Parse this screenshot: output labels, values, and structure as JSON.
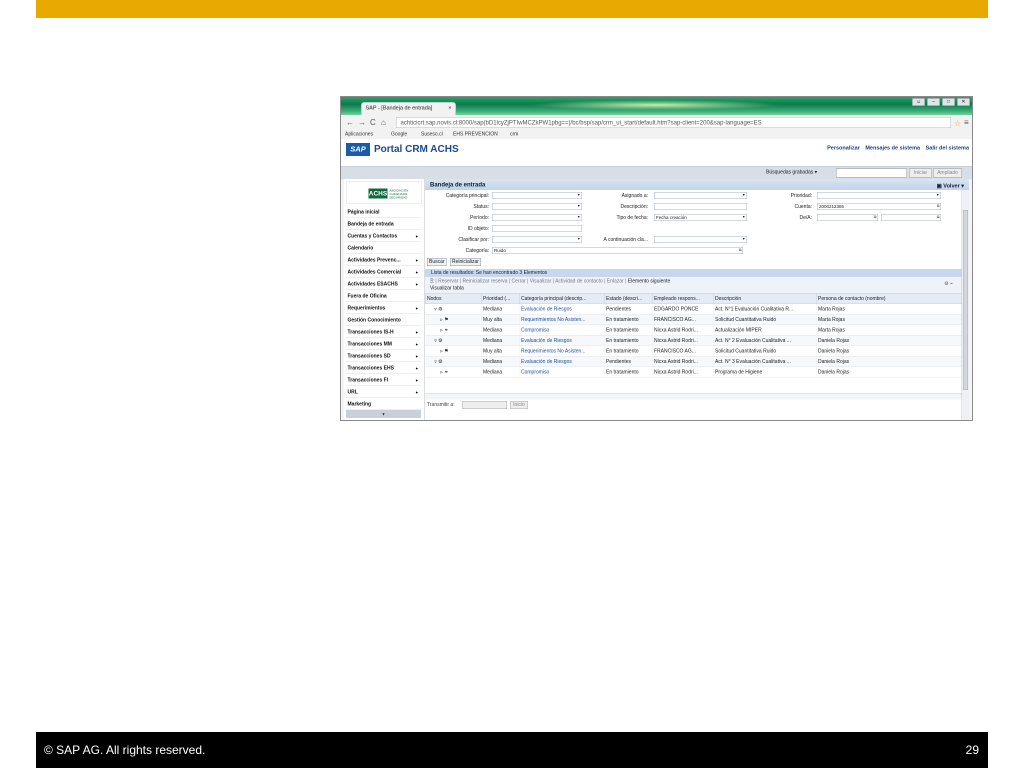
{
  "footer": {
    "copyright": "©  SAP AG. All rights reserved.",
    "page_number": "29"
  },
  "browser": {
    "tab_title": "SAP - [Bandeja de entrada]",
    "tab_close": "×",
    "url": "achticicrt.sap.novis.cl:8000/sap(bD1lcyZjPTIwMCZkPW1pbg==)/bc/bsp/sap/crm_ui_start/default.htm?sap-client=200&sap-language=ES",
    "bookmarks": [
      "Aplicaciones",
      "Google",
      "Suseso.cl",
      "EHS PREVENCION",
      "crm"
    ]
  },
  "sap": {
    "logo": "SAP",
    "portal_title": "Portal CRM ACHS",
    "header_links": [
      "Personalizar",
      "Mensajes de sistema",
      "Salir del sistema"
    ],
    "saved_searches_label": "Búsquedas grabadas",
    "start_button": "Iniciar",
    "expanded_button": "Ampliado"
  },
  "nav": {
    "logo_text": "ACHS",
    "logo_sub": "ASOCIACIÓN CHILENA DE SEGURIDAD",
    "items": [
      {
        "label": "Página inicial",
        "arrow": ""
      },
      {
        "label": "Bandeja de entrada",
        "arrow": ""
      },
      {
        "label": "Cuentas y Contactos",
        "arrow": "▸"
      },
      {
        "label": "Calendario",
        "arrow": ""
      },
      {
        "label": "Actividades Prevenc...",
        "arrow": "▸"
      },
      {
        "label": "Actividades Comercial",
        "arrow": "▸"
      },
      {
        "label": "Actividades ESACHS",
        "arrow": "▸"
      },
      {
        "label": "Fuera de Oficina",
        "arrow": ""
      },
      {
        "label": "Requerimientos",
        "arrow": "▸"
      },
      {
        "label": "Gestión Conocimiento",
        "arrow": ""
      },
      {
        "label": "Transacciones IS-H",
        "arrow": "▸"
      },
      {
        "label": "Transacciones MM",
        "arrow": "▸"
      },
      {
        "label": "Transacciones SD",
        "arrow": "▸"
      },
      {
        "label": "Transacciones EHS",
        "arrow": "▸"
      },
      {
        "label": "Transacciones FI",
        "arrow": "▸"
      },
      {
        "label": "URL",
        "arrow": "▸"
      },
      {
        "label": "Marketing",
        "arrow": ""
      }
    ]
  },
  "page": {
    "title": "Bandeja de entrada",
    "back": "Volver",
    "fields": {
      "categoria_principal": "Categoría principal:",
      "status": "Status:",
      "periodo": "Período:",
      "id_objeto": "ID objeto:",
      "clasificar_por": "Clasificar por:",
      "categoria": "Categoría:",
      "categoria_value": "Ruido",
      "asignado": "Asignado a:",
      "descripcion": "Descripción:",
      "tipo_fecha": "Tipo de fecha:",
      "tipo_fecha_value": "Fecha creación",
      "a_continuacion": "A continuación cla...",
      "prioridad": "Prioridad:",
      "cuenta": "Cuenta:",
      "cuenta_value": "2000212386",
      "de_a": "De/A:"
    },
    "buttons": {
      "buscar": "Buscar",
      "reiniciar": "Reinicializar"
    },
    "result_header": "Lista de resultados: Se han encontrado 3 Elementos",
    "toolbar": "Reservar  |  Reinicializar reserva  |  Cerrar  |  Visualizar  |  Actividad de contacto  |  Enlazar  |",
    "next_element": "Elemento siguiente",
    "view_table": "Visualizar tabla",
    "transmit": "Transmitir a:",
    "inicio": "Inicio"
  },
  "table": {
    "columns": [
      "Nodos",
      "Prioridad (...",
      "Categoría principal (descrip...",
      "Estado (descri...",
      "Empleado respons...",
      "Descripción",
      "Persona de contacto (nombre)"
    ],
    "rows": [
      {
        "node": "▿ ⚙",
        "prio": "Mediana",
        "cat": "Evaluación de Riesgos",
        "estado": "Pendientes",
        "emp": "EDGARDO PONCE",
        "desc": "Act. N°1 Evaluación Cualitativa R...",
        "contact": "Marta Rojas"
      },
      {
        "node": "▹ ⚑",
        "prio": "Muy alta",
        "cat": "Requerimientos No Asisten...",
        "estado": "En tratamiento",
        "emp": "FRANCISCO AG...",
        "desc": "Solicitud Cuantitativa Ruido",
        "contact": "Marta Rojas"
      },
      {
        "node": "▹ ⚭",
        "prio": "Mediana",
        "cat": "Compromiso",
        "estado": "En tratamiento",
        "emp": "Nicxa Astrid Rodri...",
        "desc": "Actualización MIPER",
        "contact": "Marta Rojas"
      },
      {
        "node": "▿ ⚙",
        "prio": "Mediana",
        "cat": "Evaluación de Riesgos",
        "estado": "En tratamiento",
        "emp": "Nicxa Astrid Rodri...",
        "desc": "Act. N° 2 Evaluación Cualitativa ...",
        "contact": "Daniela Rojas"
      },
      {
        "node": "▹ ⚑",
        "prio": "Muy alta",
        "cat": "Requerimientos No Asisten...",
        "estado": "En tratamiento",
        "emp": "FRANCISCO AG...",
        "desc": "Solicitud Cuantitativa Ruido",
        "contact": "Daniela Rojas"
      },
      {
        "node": "▿ ⚙",
        "prio": "Mediana",
        "cat": "Evaluación de Riesgos",
        "estado": "Pendientes",
        "emp": "Nicxa Astrid Rodri...",
        "desc": "Act. N° 3 Evaluación Cualitativa ...",
        "contact": "Daniela Rojas"
      },
      {
        "node": "▹ ⚭",
        "prio": "Mediana",
        "cat": "Compromiso",
        "estado": "En tratamiento",
        "emp": "Nicxa Astrid Rodri...",
        "desc": "Programa de Higiene",
        "contact": "Daniela Rojas"
      }
    ]
  }
}
